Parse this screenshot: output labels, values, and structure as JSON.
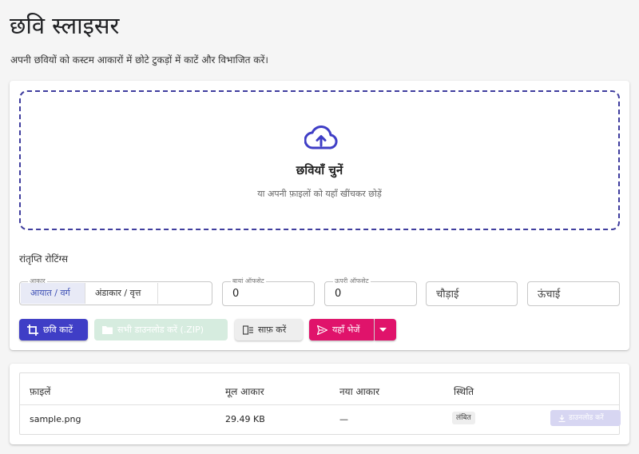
{
  "header": {
    "title": "छवि स्लाइसर",
    "subtitle": "अपनी छवियों को कस्टम आकारों में छोटे टुकड़ों में काटें और विभाजित करें।"
  },
  "dropzone": {
    "icon": "cloud-upload-icon",
    "title": "छवियाँ चुनें",
    "hint": "या अपनी फ़ाइलों को यहाँ खींचकर छोड़ें"
  },
  "settings": {
    "label": "रांतृप्ति रोटिंग्स",
    "shape": {
      "legend": "आकार",
      "options": [
        "आयात / वर्ग",
        "अंडाकार / वृत्त"
      ],
      "selected": "आयात / वर्ग"
    },
    "left_offset": {
      "legend": "बायां ऑफसेट",
      "value": "0"
    },
    "top_offset": {
      "legend": "ऊपरी ऑफसेट",
      "value": "0"
    },
    "width": {
      "placeholder": "चौड़ाई"
    },
    "height": {
      "placeholder": "ऊंचाई"
    }
  },
  "actions": {
    "crop": "छवि काटें",
    "download_all": "सभी डाउनलोड करें (.ZIP)",
    "clear": "साफ़ करें",
    "send": "यहाँ भेजें"
  },
  "table": {
    "headers": [
      "फ़ाइलें",
      "मूल आकार",
      "नया आकार",
      "स्थिति"
    ],
    "rows": [
      {
        "file": "sample.png",
        "original_size": "29.49 KB",
        "new_size": "—",
        "status": "लंबित",
        "download": "डाउनलोड करें"
      }
    ]
  },
  "colors": {
    "primary": "#3f3ec6",
    "accent": "#e0136b",
    "success_disabled": "#d6ecdf",
    "dropzone_border": "#3f3d9e"
  }
}
